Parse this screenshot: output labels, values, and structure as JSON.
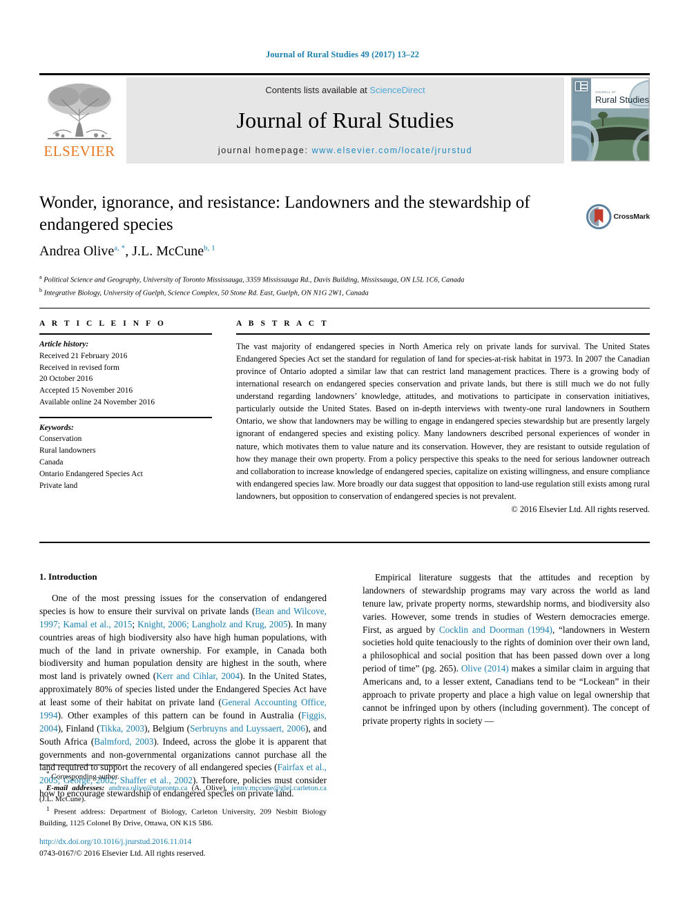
{
  "running_head": "Journal of Rural Studies 49 (2017) 13–22",
  "masthead": {
    "contents_prefix": "Contents lists available at ",
    "sciencedirect": "ScienceDirect",
    "journal_name": "Journal of Rural Studies",
    "homepage_prefix": "journal homepage: ",
    "homepage_url": "www.elsevier.com/locate/jrurstud",
    "publisher": "ELSEVIER",
    "cover_title_small": "Journal of",
    "cover_title": "Rural Studies"
  },
  "article": {
    "title": "Wonder, ignorance, and resistance: Landowners and the stewardship of endangered species",
    "authors_plain": "Andrea Olive a, *, J.L. McCune b, 1",
    "author_1": "Andrea Olive",
    "author_1_sup": "a, *",
    "author_2": "J.L. McCune",
    "author_2_sup": "b, 1",
    "crossmark_label": "CrossMark",
    "affiliation_a_sup": "a",
    "affiliation_a": "Political Science and Geography, University of Toronto Mississauga, 3359 Mississauga Rd., Davis Building, Mississauga, ON L5L 1C6, Canada",
    "affiliation_b_sup": "b",
    "affiliation_b": "Integrative Biology, University of Guelph, Science Complex, 50 Stone Rd. East, Guelph, ON N1G 2W1, Canada"
  },
  "article_info": {
    "heading": "A R T I C L E  I N F O",
    "history_label": "Article history:",
    "history": [
      "Received 21 February 2016",
      "Received in revised form",
      "20 October 2016",
      "Accepted 15 November 2016",
      "Available online 24 November 2016"
    ],
    "keywords_label": "Keywords:",
    "keywords": [
      "Conservation",
      "Rural landowners",
      "Canada",
      "Ontario Endangered Species Act",
      "Private land"
    ]
  },
  "abstract": {
    "heading": "A B S T R A C T",
    "text": "The vast majority of endangered species in North America rely on private lands for survival. The United States Endangered Species Act set the standard for regulation of land for species-at-risk habitat in 1973. In 2007 the Canadian province of Ontario adopted a similar law that can restrict land management practices. There is a growing body of international research on endangered species conservation and private lands, but there is still much we do not fully understand regarding landowners’ knowledge, attitudes, and motivations to participate in conservation initiatives, particularly outside the United States. Based on in-depth interviews with twenty-one rural landowners in Southern Ontario, we show that landowners may be willing to engage in endangered species stewardship but are presently largely ignorant of endangered species and existing policy. Many landowners described personal experiences of wonder in nature, which motivates them to value nature and its conservation. However, they are resistant to outside regulation of how they manage their own property. From a policy perspective this speaks to the need for serious landowner outreach and collaboration to increase knowledge of endangered species, capitalize on existing willingness, and ensure compliance with endangered species law. More broadly our data suggest that opposition to land-use regulation still exists among rural landowners, but opposition to conservation of endangered species is not prevalent.",
    "copyright": "© 2016 Elsevier Ltd. All rights reserved."
  },
  "body": {
    "section_number_title": "1. Introduction",
    "left_p1_seg1": "One of the most pressing issues for the conservation of endangered species is how to ensure their survival on private lands (",
    "left_p1_ref1": "Bean and Wilcove, 1997; Kamal et al., 2015",
    "left_p1_seg2": "; ",
    "left_p1_ref2": "Knight, 2006; Langholz and Krug, 2005",
    "left_p1_seg3": "). In many countries areas of high biodiversity also have high human populations, with much of the land in private ownership. For example, in Canada both biodiversity and human population density are highest in the south, where most land is privately owned (",
    "left_p1_ref3": "Kerr and Cihlar, 2004",
    "left_p1_seg4": "). In the United States, approximately 80% of species listed under the Endangered Species Act have at least some of their habitat on private land (",
    "left_p1_ref4": "General Accounting Office, 1994",
    "left_p1_seg5": "). Other examples of this pattern can be found in Australia (",
    "left_p1_ref5": "Figgis, 2004",
    "left_p1_seg6": "), Finland (",
    "left_p1_ref6": "Tikka, 2003",
    "left_p1_seg7": "), Belgium (",
    "left_p1_ref7": "Serbruyns and Luyssaert, 2006",
    "left_p1_seg8": "), and South Africa (",
    "left_p1_ref8": "Balmford, 2003",
    "left_p1_seg9": "). Indeed, across the globe it is apparent that governments and non-governmental organizations cannot purchase all the land required to support the recovery of all endangered species (",
    "left_p1_ref9": "Fairfax et al., 2005; George, 2002; Shaffer et al., 2002",
    "left_p1_seg10": "). Therefore, policies must consider how to encourage stewardship of endangered species on private land.",
    "right_p2_seg1": "Empirical literature suggests that the attitudes and reception by landowners of stewardship programs may vary across the world as land tenure law, private property norms, stewardship norms, and biodiversity also varies. However, some trends in studies of Western democracies emerge. First, as argued by ",
    "right_p2_ref1": "Cocklin and Doorman (1994)",
    "right_p2_seg2": ", “landowners in Western societies hold quite tenaciously to the rights of dominion over their own land, a philosophical and social position that has been passed down over a long period of time” (pg. 265). ",
    "right_p2_ref2": "Olive (2014)",
    "right_p2_seg3": " makes a similar claim in arguing that Americans and, to a lesser extent, Canadians tend to be “Lockean” in their approach to private property and place a high value on legal ownership that cannot be infringed upon by others (including government). The concept of private property rights in society —"
  },
  "footnotes": {
    "corresponding_marker": "*",
    "corresponding": "Corresponding author.",
    "email_label": "E-mail addresses:",
    "email_1": "andrea.olive@utoronto.ca",
    "email_1_attr": " (A. Olive), ",
    "email_2": "jenny.mccune@glel.carleton.ca",
    "email_2_attr": " (J.L. McCune).",
    "present_marker": "1",
    "present_address": "Present address: Department of Biology, Carleton University, 209 Nesbitt Biology Building, 1125 Colonel By Drive, Ottawa, ON K1S 5B6.",
    "doi_url": "http://dx.doi.org/10.1016/j.jrurstud.2016.11.014",
    "issn_copyright": "0743-0167/© 2016 Elsevier Ltd. All rights reserved."
  },
  "colors": {
    "link_blue": "#1a7fae",
    "sciencedirect_blue": "#4ea8d8",
    "elsevier_orange": "#e87722",
    "masthead_gray": "#e6e6e6"
  }
}
